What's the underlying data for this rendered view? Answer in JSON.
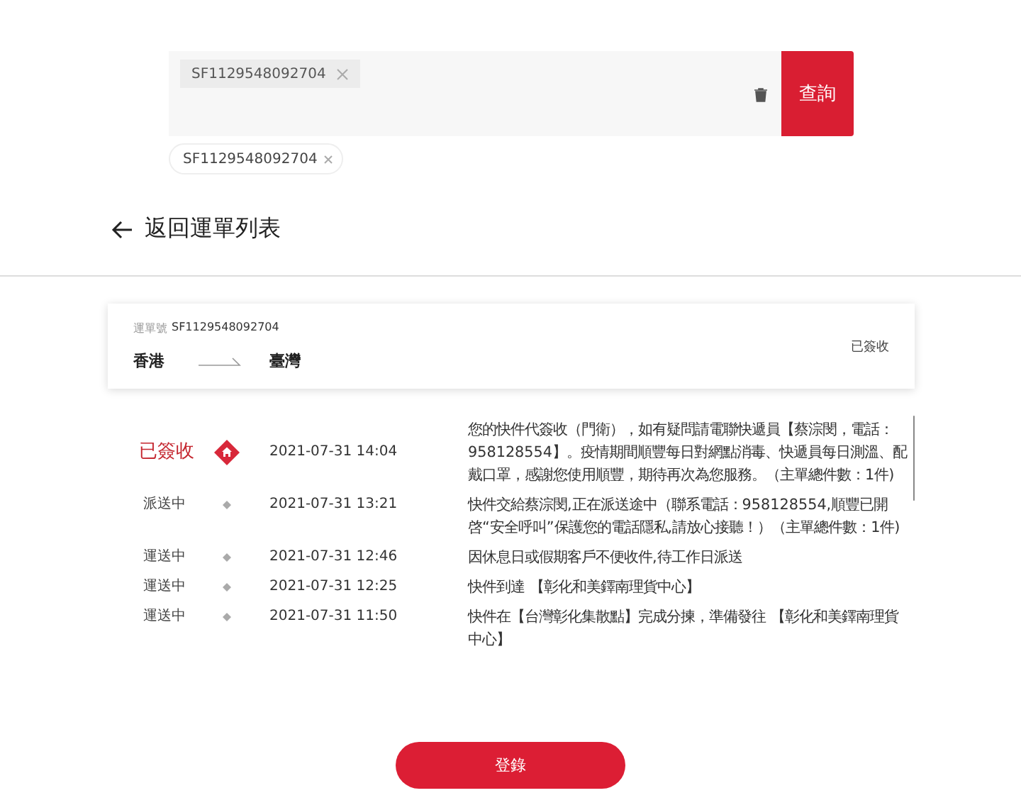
{
  "search": {
    "tags": [
      "SF1129548092704"
    ],
    "button": "查詢"
  },
  "history_chips": [
    "SF1129548092704"
  ],
  "back_link": "返回運單列表",
  "waybill": {
    "label": "運單號",
    "number": "SF1129548092704",
    "origin": "香港",
    "destination": "臺灣",
    "status": "已簽收"
  },
  "timeline": [
    {
      "status": "已簽收",
      "current": true,
      "time": "2021-07-31 14:04",
      "description": "您的快件代簽收（門衛），如有疑問請電聯快遞員【蔡淙閔，電話：958128554】。疫情期間順豐每日對網點消毒、快遞員每日測溫、配戴口罩，感謝您使用順豐，期待再次為您服務。（主單總件數：1件)"
    },
    {
      "status": "派送中",
      "current": false,
      "time": "2021-07-31 13:21",
      "description": "快件交給蔡淙閔,正在派送途中（聯系電話：958128554,順豐已開啓“安全呼叫”保護您的電話隱私,請放心接聽！）（主單總件數：1件)"
    },
    {
      "status": "運送中",
      "current": false,
      "time": "2021-07-31 12:46",
      "description": "因休息日或假期客戶不便收件,待工作日派送"
    },
    {
      "status": "運送中",
      "current": false,
      "time": "2021-07-31 12:25",
      "description": "快件到達 【彰化和美鐸南理貨中心】"
    },
    {
      "status": "運送中",
      "current": false,
      "time": "2021-07-31 11:50",
      "description": "快件在【台灣彰化集散點】完成分揀，準備發往 【彰化和美鐸南理貨中心】"
    }
  ],
  "login_button": "登錄"
}
